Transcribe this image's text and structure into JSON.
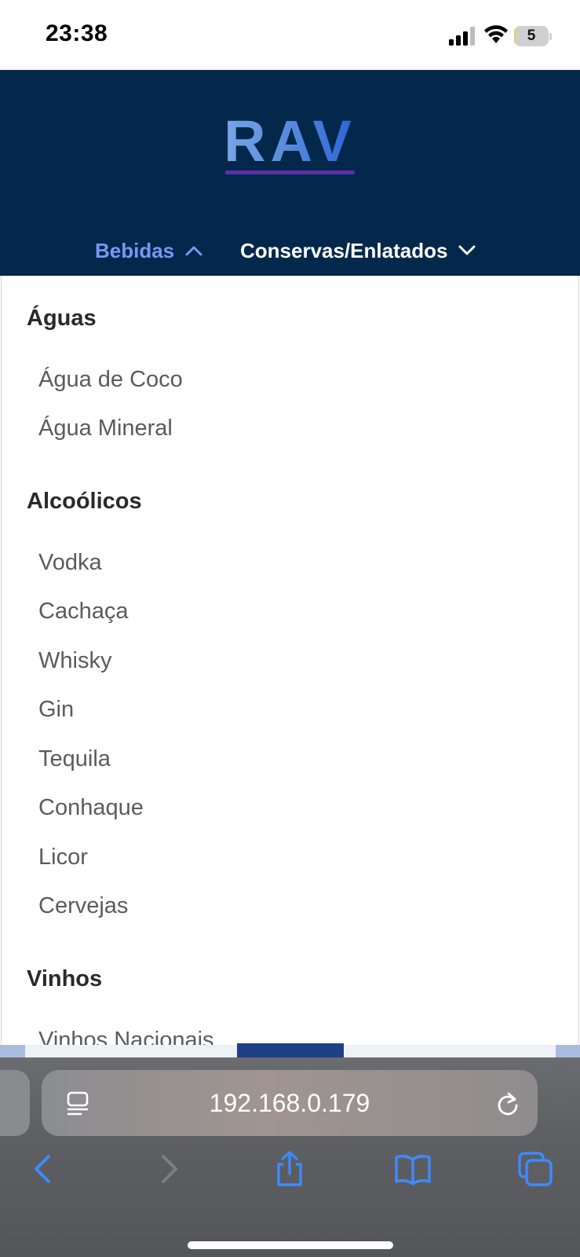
{
  "status_bar": {
    "time": "23:38",
    "battery_level": "5",
    "battery_fraction": 0.05,
    "battery_color": "#e9d05a",
    "icons": [
      "signal-icon",
      "wifi-icon",
      "battery-icon"
    ]
  },
  "header": {
    "logo_text": "RAV",
    "background_color": "#03284b",
    "nav": [
      {
        "label": "Bebidas",
        "expanded": true,
        "icon": "chevron-up-icon",
        "color": "#7c95f4"
      },
      {
        "label": "Conservas/Enlatados",
        "expanded": false,
        "icon": "chevron-down-icon",
        "color": "#ffffff"
      }
    ]
  },
  "dropdown": {
    "groups": [
      {
        "title": "Águas",
        "items": [
          "Água de Coco",
          "Água Mineral"
        ]
      },
      {
        "title": "Alcoólicos",
        "items": [
          "Vodka",
          "Cachaça",
          "Whisky",
          "Gin",
          "Tequila",
          "Conhaque",
          "Licor",
          "Cervejas"
        ]
      },
      {
        "title": "Vinhos",
        "items": [
          "Vinhos Nacionais"
        ]
      }
    ]
  },
  "browser": {
    "url": "192.168.0.179",
    "icons": [
      "reader-icon",
      "reload-icon",
      "back-icon",
      "forward-icon",
      "share-icon",
      "bookmarks-icon",
      "tabs-icon"
    ],
    "accent_color": "#3d8bff"
  }
}
